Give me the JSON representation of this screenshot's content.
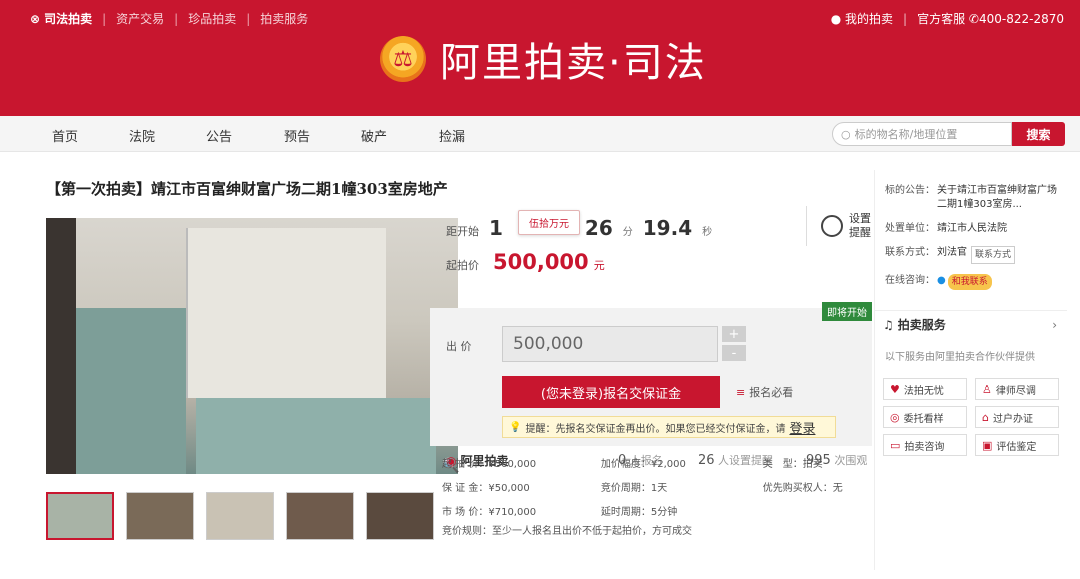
{
  "topbar": {
    "brand": "司法拍卖",
    "links": [
      "资产交易",
      "珍品拍卖",
      "拍卖服务"
    ],
    "my_auction": "我的拍卖",
    "service_label": "官方客服",
    "phone": "400-822-2870"
  },
  "logo": {
    "text": "阿里拍卖·司法"
  },
  "nav": {
    "items": [
      "首页",
      "法院",
      "公告",
      "预告",
      "破产",
      "捡漏"
    ],
    "search_placeholder": "标的物名称/地理位置",
    "search_button": "搜索"
  },
  "item": {
    "title": "【第一次拍卖】靖江市百富绅财富广场二期1幢303室房地产",
    "countdown_label": "距开始",
    "countdown_lead": "1",
    "tooltip": "伍拾万元",
    "countdown_min": "26",
    "min_unit": "分",
    "countdown_sec": "19.4",
    "sec_unit": "秒",
    "remind_label": "设置提醒",
    "start_price_label": "起拍价",
    "start_price": "500,000",
    "price_unit": "元",
    "start_badge": "即将开始",
    "bid_label": "出 价",
    "bid_value": "500,000",
    "step_plus": "+",
    "step_minus": "-",
    "signup_button": "(您未登录)报名交保证金",
    "must_read": "报名必看",
    "notice": "提醒：先报名交保证金再出价。如果您已经交付保证金，请",
    "login": "登录"
  },
  "stats": {
    "brand": "阿里拍卖",
    "signups": "0",
    "signups_label": "人报名",
    "reminders": "26",
    "reminders_label": "人设置提醒",
    "views": "995",
    "views_label": "次围观"
  },
  "details": {
    "rows": [
      [
        "起 拍 价：¥500,000",
        "加价幅度：¥2,000",
        "类　型：拍卖"
      ],
      [
        "保 证 金：¥50,000",
        "竞价周期：1天",
        "优先购买权人：无"
      ],
      [
        "市 场 价：¥710,000",
        "延时周期：5分钟",
        ""
      ]
    ],
    "rule": "竞价规则：至少一人报名且出价不低于起拍价，方可成交"
  },
  "side": {
    "announce_label": "标的公告：",
    "announce_value": "关于靖江市百富绅财富广场二期1幢303室房...",
    "unit_label": "处置单位：",
    "unit_value": "靖江市人民法院",
    "contact_label": "联系方式：",
    "contact_name": "刘法官",
    "contact_button": "联系方式",
    "consult_label": "在线咨询：",
    "consult_button": "和我联系",
    "service_title": "拍卖服务",
    "service_desc": "以下服务由阿里拍卖合作伙伴提供",
    "services": [
      "法拍无忧",
      "律师尽调",
      "委托看样",
      "过户办证",
      "拍卖咨询",
      "评估鉴定"
    ]
  },
  "colors": {
    "brand_red": "#c8162f",
    "badge_green": "#2f8a3c"
  }
}
